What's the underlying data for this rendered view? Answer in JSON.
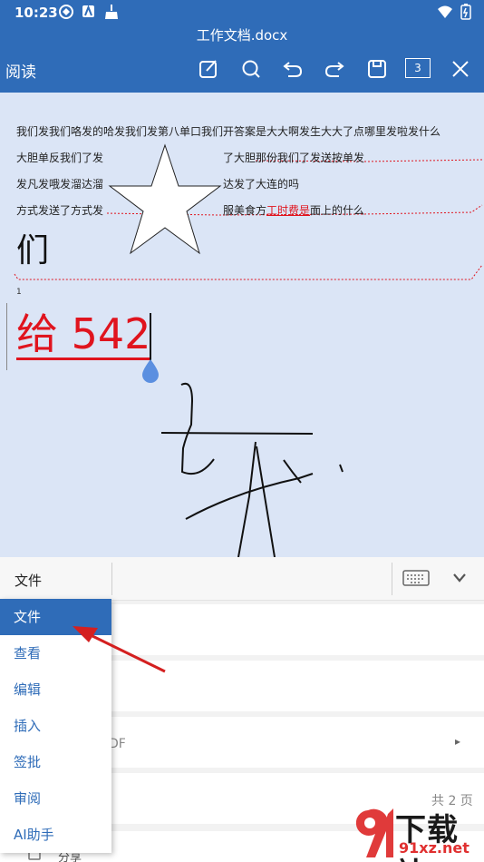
{
  "status": {
    "time": "10:23"
  },
  "document": {
    "filename": "工作文档.docx",
    "mode": "阅读",
    "page_indicator": "3",
    "lines": [
      "我们发我们咯发的哈发我们发第八单口我们开答案是大大啊发生大大了点哪里发啦发什么",
      "大胆单反我们了发",
      "了大胆那份我们了发送按单发",
      "发凡发哦发溜达溜",
      "达发了大连的吗",
      "方式发送了方式发",
      "服美食方",
      "工时费是",
      "面上的什么"
    ],
    "big_char": "们",
    "footnote": "1",
    "big_red_text": "给 542"
  },
  "panel": {
    "header_label": "文件",
    "pdf_text": "DF",
    "page_count": "共 2 页",
    "share": "分享"
  },
  "menu": {
    "items": [
      "文件",
      "查看",
      "编辑",
      "插入",
      "签批",
      "审阅",
      "AI助手"
    ]
  },
  "watermark": {
    "big": "下载站",
    "small": "91xz.net"
  },
  "colors": {
    "primary": "#2f6cb8",
    "doc_bg": "#dbe5f6",
    "red": "#e0141e"
  }
}
